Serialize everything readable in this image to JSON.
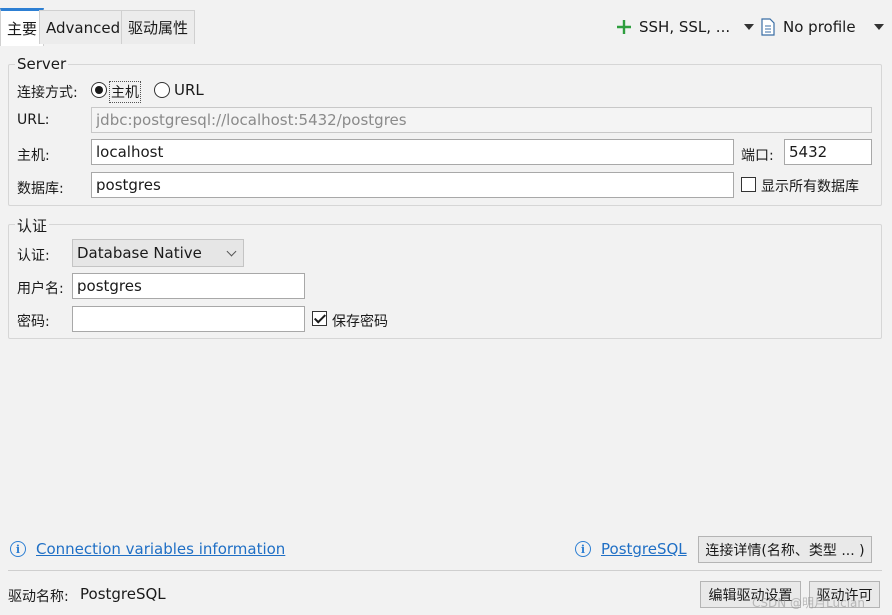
{
  "tabs": [
    {
      "label": "主要",
      "active": true
    },
    {
      "label": "Advanced",
      "active": false
    },
    {
      "label": "驱动属性",
      "active": false
    }
  ],
  "toolbar": {
    "ssh_label": "SSH, SSL, ...",
    "profile_label": "No profile"
  },
  "server": {
    "legend": "Server",
    "connect_mode_label": "连接方式:",
    "radio_host_label": "主机",
    "radio_url_label": "URL",
    "selected_mode": "主机",
    "url_label": "URL:",
    "url_value": "jdbc:postgresql://localhost:5432/postgres",
    "host_label": "主机:",
    "host_value": "localhost",
    "port_label": "端口:",
    "port_value": "5432",
    "database_label": "数据库:",
    "database_value": "postgres",
    "show_all_db_label": "显示所有数据库",
    "show_all_db_checked": false
  },
  "auth": {
    "legend": "认证",
    "auth_label": "认证:",
    "auth_value": "Database Native",
    "username_label": "用户名:",
    "username_value": "postgres",
    "password_label": "密码:",
    "password_value": "",
    "save_password_label": "保存密码",
    "save_password_checked": true
  },
  "footer": {
    "conn_vars_link": "Connection variables information",
    "postgresql_link": "PostgreSQL",
    "conn_details_button": "连接详情(名称、类型 ... )",
    "driver_name_label": "驱动名称:",
    "driver_name_value": "PostgreSQL",
    "edit_driver_button": "编辑驱动设置",
    "driver_license_button": "驱动许可",
    "watermark": "CSDN @明月Lucian"
  },
  "colors": {
    "accent": "#2d7fd3",
    "plus_icon": "#2e9e3e",
    "link": "#1f6fc5"
  },
  "icons": {
    "plus": "plus-icon",
    "profile": "document-icon",
    "info": "info-icon"
  }
}
